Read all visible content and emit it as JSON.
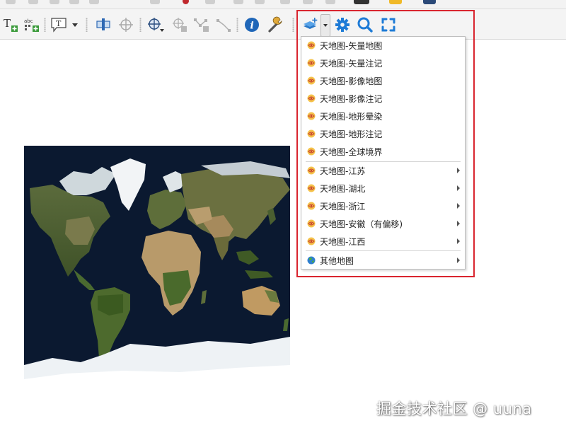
{
  "menu": {
    "items": [
      {
        "label": "天地图-矢量地图",
        "icon": "tianditu-layer-icon",
        "submenu": false
      },
      {
        "label": "天地图-矢量注记",
        "icon": "tianditu-layer-icon",
        "submenu": false
      },
      {
        "label": "天地图-影像地图",
        "icon": "tianditu-layer-icon",
        "submenu": false
      },
      {
        "label": "天地图-影像注记",
        "icon": "tianditu-layer-icon",
        "submenu": false
      },
      {
        "label": "天地图-地形晕染",
        "icon": "tianditu-layer-icon",
        "submenu": false
      },
      {
        "label": "天地图-地形注记",
        "icon": "tianditu-layer-icon",
        "submenu": false
      },
      {
        "label": "天地图-全球境界",
        "icon": "tianditu-layer-icon",
        "submenu": false
      },
      {
        "label": "天地图-江苏",
        "icon": "tianditu-layer-icon",
        "submenu": true
      },
      {
        "label": "天地图-湖北",
        "icon": "tianditu-layer-icon",
        "submenu": true
      },
      {
        "label": "天地图-浙江",
        "icon": "tianditu-layer-icon",
        "submenu": true
      },
      {
        "label": "天地图-安徽（有偏移)",
        "icon": "tianditu-layer-icon",
        "submenu": true
      },
      {
        "label": "天地图-江西",
        "icon": "tianditu-layer-icon",
        "submenu": true
      },
      {
        "label": "其他地图",
        "icon": "globe-icon",
        "submenu": true
      }
    ]
  },
  "watermark": "掘金技术社区 @ uuna",
  "colors": {
    "highlight": "#d9252f",
    "plugin_blue": "#1e7bd6",
    "ocean": "#0b1930"
  }
}
